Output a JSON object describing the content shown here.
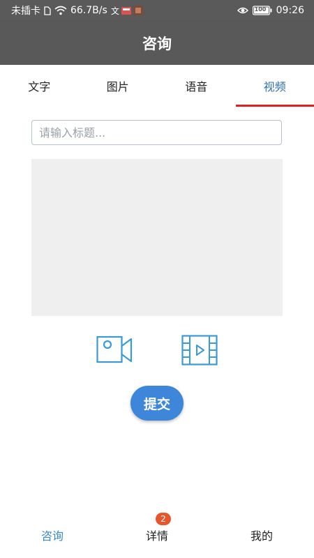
{
  "status_bar": {
    "carrier": "未插卡",
    "speed": "66.7B/s",
    "battery": "100",
    "time": "09:26",
    "icons": [
      "sim-icon",
      "wifi-icon",
      "notification-app-icons",
      "eye-icon",
      "battery-icon"
    ]
  },
  "app_bar": {
    "title": "咨询"
  },
  "tabs": [
    {
      "label": "文字",
      "active": false
    },
    {
      "label": "图片",
      "active": false
    },
    {
      "label": "语音",
      "active": false
    },
    {
      "label": "视频",
      "active": true
    }
  ],
  "form": {
    "title_placeholder": "请输入标题...",
    "title_value": "",
    "record_icon": "video-camera-icon",
    "library_icon": "film-strip-icon",
    "submit_label": "提交"
  },
  "bottom_nav": [
    {
      "label": "咨询",
      "active": true
    },
    {
      "label": "详情",
      "active": false,
      "badge": "2"
    },
    {
      "label": "我的",
      "active": false
    }
  ],
  "colors": {
    "header_bg": "#595959",
    "tab_active_text": "#2f6fb6",
    "tab_indicator": "#e02020",
    "primary": "#3d86d9",
    "icon_stroke": "#3a9ad9",
    "badge": "#e8562c"
  }
}
